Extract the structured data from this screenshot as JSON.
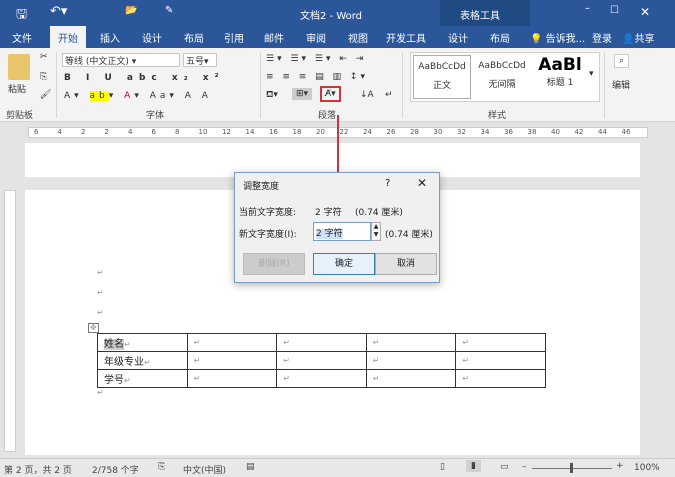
{
  "title": "文档2 - Word",
  "context_tab": "表格工具",
  "tabs": [
    "文件",
    "开始",
    "插入",
    "设计",
    "布局",
    "引用",
    "邮件",
    "审阅",
    "视图",
    "开发工具",
    "设计",
    "布局"
  ],
  "tell_me": "告诉我...",
  "login": "登录",
  "share": "共享",
  "ribbon": {
    "paste": "粘贴",
    "font_name": "等线 (中文正文)",
    "font_size": "五号",
    "groups": [
      "剪贴板",
      "字体",
      "段落",
      "样式",
      "编辑"
    ],
    "styles": [
      {
        "preview": "AaBbCcDd",
        "name": "正文"
      },
      {
        "preview": "AaBbCcDd",
        "name": "无间隔"
      },
      {
        "preview": "AaBl",
        "name": "标题 1"
      }
    ],
    "edit": "编辑"
  },
  "ruler_ticks": [
    "6",
    "4",
    "2",
    "2",
    "4",
    "6",
    "8",
    "10",
    "12",
    "14",
    "16",
    "18",
    "20",
    "22",
    "24",
    "26",
    "28",
    "30",
    "32",
    "34",
    "36",
    "38",
    "40",
    "42",
    "44",
    "46"
  ],
  "dialog": {
    "title": "调整宽度",
    "help": "?",
    "current_label": "当前文字宽度:",
    "current_value": "2 字符",
    "current_cm": "(0.74 厘米)",
    "new_label": "新文字宽度(I):",
    "new_value": "2 字符",
    "new_cm": "(0.74 厘米)",
    "delete": "删除(R)",
    "ok": "确定",
    "cancel": "取消"
  },
  "table": [
    [
      "姓名",
      "",
      "",
      "",
      ""
    ],
    [
      "年级专业",
      "",
      "",
      "",
      ""
    ],
    [
      "学号",
      "",
      "",
      "",
      ""
    ]
  ],
  "status": {
    "page": "第 2 页，共 2 页",
    "words": "2/758 个字",
    "lang": "中文(中国)",
    "zoom": "100%"
  },
  "colors": {
    "brand": "#2b579a",
    "highlight": "#d13438"
  }
}
